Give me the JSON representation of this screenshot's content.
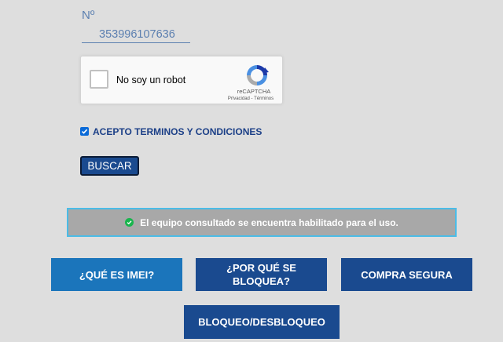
{
  "form": {
    "number_label": "Nº",
    "number_value": "353996107636"
  },
  "recaptcha": {
    "label": "No soy un robot",
    "brand": "reCAPTCHA",
    "links": "Privacidad - Términos",
    "logo_icon": "recaptcha-logo-icon"
  },
  "terms": {
    "label": "ACEPTO TERMINOS Y CONDICIONES",
    "checked": true,
    "check_color": "#0a6ad8"
  },
  "search_button": {
    "label": "BUSCAR"
  },
  "status": {
    "icon": "check-circle-icon",
    "icon_color": "#19b54d",
    "text": "El equipo consultado se encuentra habilitado para el uso."
  },
  "nav": {
    "imei": "¿QUÉ ES IMEI?",
    "porque": "¿POR QUÉ SE BLOQUEA?",
    "compra": "COMPRA SEGURA",
    "bloqueo": "BLOQUEO/DESBLOQUEO"
  },
  "colors": {
    "background": "#dedede",
    "primary": "#1a4a8f",
    "accent": "#1b75bb",
    "status_border": "#4bbce6"
  }
}
